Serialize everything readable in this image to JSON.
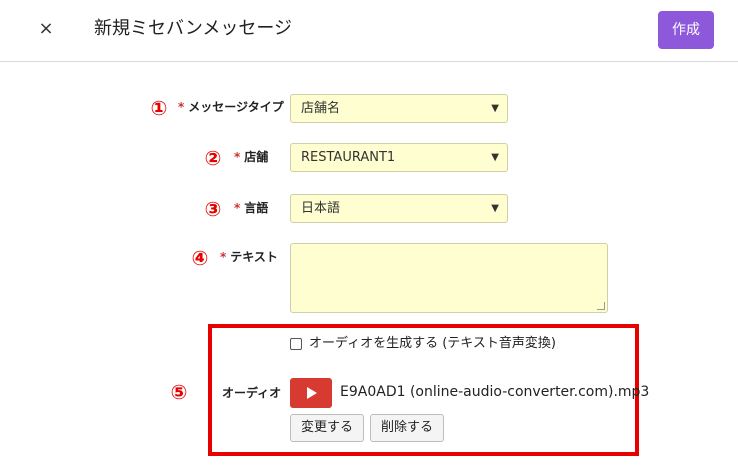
{
  "header": {
    "close_label": "×",
    "title": "新規ミセバンメッセージ",
    "create_label": "作成"
  },
  "markers": [
    "①",
    "②",
    "③",
    "④",
    "⑤"
  ],
  "form": {
    "required_mark": "*",
    "message_type": {
      "label": "メッセージタイプ",
      "value": "店舗名"
    },
    "store": {
      "label": "店舗",
      "value": "RESTAURANT1"
    },
    "language": {
      "label": "言語",
      "value": "日本語"
    },
    "text": {
      "label": "テキスト",
      "value": ""
    },
    "audio": {
      "label": "オーディオ",
      "generate_checkbox_label": "オーディオを生成する (テキスト音声変換)",
      "generate_checked": false,
      "filename": "E9A0AD1 (online-audio-converter.com).mp3",
      "change_label": "変更する",
      "delete_label": "削除する"
    }
  },
  "colors": {
    "accent": "#8e58db",
    "marker": "#e60000",
    "field_bg": "#fffed0",
    "play": "#d63a30"
  }
}
